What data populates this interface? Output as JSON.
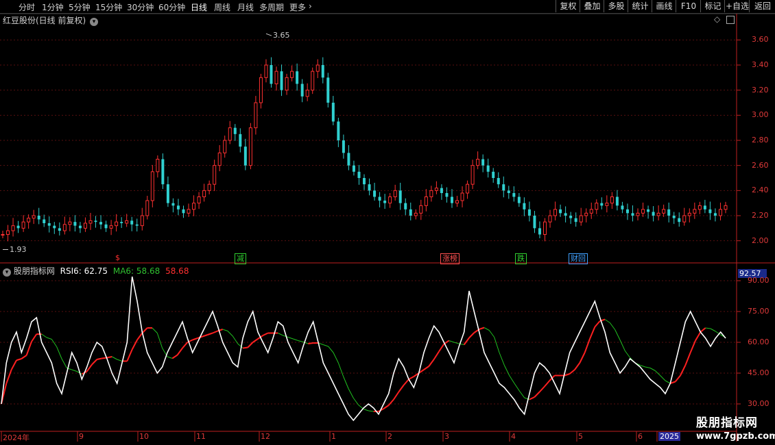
{
  "toolbar": {
    "periods": [
      "分时",
      "1分钟",
      "5分钟",
      "15分钟",
      "30分钟",
      "60分钟",
      "日线",
      "周线",
      "月线",
      "多周期",
      "更多"
    ],
    "active_period": "日线",
    "more_arrow": "›",
    "buttons": [
      "复权",
      "叠加",
      "多股",
      "统计",
      "画线",
      "F10",
      "标记",
      "+自选",
      "返回"
    ]
  },
  "main_chart": {
    "title": "红豆股份(日线 前复权)",
    "high_label": "3.65",
    "low_label": "1.93",
    "price_ticks": [
      "3.60",
      "3.40",
      "3.20",
      "3.00",
      "2.80",
      "2.60",
      "2.40",
      "2.20",
      "2.00"
    ],
    "signals": [
      {
        "label": "$",
        "color": "#ff3030"
      },
      {
        "label": "减",
        "color": "#30d030"
      },
      {
        "label": "涨榜",
        "color": "#ff5050"
      },
      {
        "label": "跌",
        "color": "#30d030"
      },
      {
        "label": "财回",
        "color": "#40a0ff"
      }
    ],
    "up_color": "#ff3030",
    "down_color": "#30d0d0"
  },
  "indicator": {
    "name": "股朋指标网",
    "rsi_label": "RSI6: 62.75",
    "ma_label": "MA6: 58.68",
    "extra_label": "58.68",
    "top_value": "92.57",
    "ticks": [
      "90.00",
      "75.00",
      "60.00",
      "45.00",
      "30.00"
    ],
    "rsi_color": "#ffffff",
    "ma_up_color": "#ff2020",
    "ma_down_color": "#20c020"
  },
  "dates": [
    {
      "label": "2024年"
    },
    {
      "label": "9"
    },
    {
      "label": "10"
    },
    {
      "label": "11"
    },
    {
      "label": "12"
    },
    {
      "label": "1"
    },
    {
      "label": "2"
    },
    {
      "label": "3"
    },
    {
      "label": "4"
    },
    {
      "label": "5"
    },
    {
      "label": "6"
    },
    {
      "label": "2025"
    }
  ],
  "watermark": {
    "line1": "股朋指标网",
    "line2": "www.7gpzb.com"
  },
  "chart_data": {
    "type": "line",
    "main": {
      "kind": "candlestick",
      "ylim": [
        1.9,
        3.7
      ],
      "close": [
        2.05,
        2.08,
        2.12,
        2.1,
        2.15,
        2.18,
        2.2,
        2.17,
        2.14,
        2.12,
        2.1,
        2.08,
        2.13,
        2.15,
        2.12,
        2.1,
        2.14,
        2.16,
        2.15,
        2.13,
        2.1,
        2.12,
        2.15,
        2.14,
        2.16,
        2.13,
        2.12,
        2.2,
        2.32,
        2.55,
        2.65,
        2.45,
        2.3,
        2.28,
        2.25,
        2.22,
        2.25,
        2.3,
        2.35,
        2.4,
        2.45,
        2.6,
        2.7,
        2.8,
        2.9,
        2.85,
        2.75,
        2.6,
        2.9,
        3.1,
        3.3,
        3.4,
        3.25,
        3.35,
        3.2,
        3.3,
        3.35,
        3.25,
        3.15,
        3.2,
        3.35,
        3.4,
        3.3,
        3.1,
        2.95,
        2.8,
        2.7,
        2.6,
        2.55,
        2.5,
        2.45,
        2.4,
        2.35,
        2.32,
        2.3,
        2.35,
        2.4,
        2.3,
        2.25,
        2.2,
        2.22,
        2.28,
        2.35,
        2.4,
        2.42,
        2.38,
        2.35,
        2.3,
        2.32,
        2.38,
        2.45,
        2.6,
        2.65,
        2.6,
        2.55,
        2.5,
        2.45,
        2.4,
        2.38,
        2.35,
        2.3,
        2.25,
        2.2,
        2.1,
        2.05,
        2.15,
        2.2,
        2.25,
        2.22,
        2.2,
        2.18,
        2.15,
        2.2,
        2.22,
        2.25,
        2.3,
        2.28,
        2.3,
        2.35,
        2.28,
        2.25,
        2.22,
        2.2,
        2.22,
        2.25,
        2.23,
        2.2,
        2.22,
        2.25,
        2.2,
        2.18,
        2.15,
        2.2,
        2.22,
        2.25,
        2.28,
        2.25,
        2.22,
        2.2,
        2.25,
        2.28
      ]
    },
    "indicator": {
      "ylim": [
        20,
        95
      ],
      "rsi": [
        30,
        50,
        60,
        65,
        55,
        62,
        70,
        72,
        60,
        55,
        50,
        40,
        35,
        45,
        55,
        50,
        42,
        48,
        55,
        60,
        58,
        52,
        45,
        40,
        50,
        60,
        92,
        80,
        65,
        55,
        50,
        45,
        48,
        55,
        60,
        65,
        70,
        62,
        55,
        60,
        65,
        70,
        75,
        68,
        60,
        55,
        50,
        48,
        62,
        70,
        75,
        65,
        60,
        55,
        62,
        70,
        68,
        60,
        55,
        50,
        58,
        65,
        70,
        60,
        50,
        45,
        40,
        35,
        30,
        25,
        22,
        25,
        28,
        30,
        28,
        25,
        30,
        35,
        45,
        52,
        48,
        42,
        38,
        45,
        55,
        62,
        68,
        65,
        60,
        55,
        50,
        58,
        65,
        85,
        75,
        65,
        55,
        50,
        45,
        40,
        38,
        35,
        32,
        28,
        25,
        35,
        45,
        50,
        48,
        45,
        40,
        35,
        45,
        55,
        60,
        65,
        70,
        75,
        80,
        72,
        65,
        55,
        50,
        45,
        48,
        52,
        50,
        48,
        45,
        42,
        40,
        38,
        35,
        40,
        50,
        60,
        70,
        75,
        70,
        65,
        62,
        58,
        62,
        65,
        62
      ]
    }
  }
}
